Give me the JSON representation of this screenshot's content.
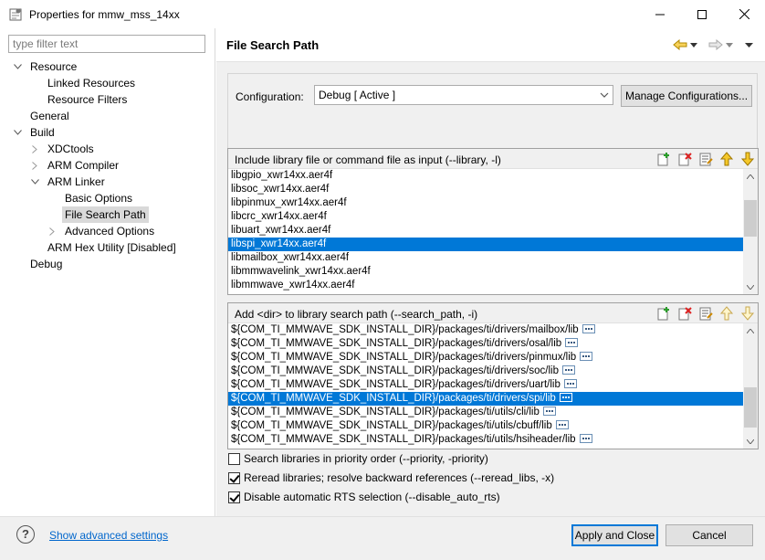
{
  "window": {
    "title": "Properties for mmw_mss_14xx"
  },
  "filter": {
    "placeholder": "type filter text"
  },
  "tree": {
    "resource": "Resource",
    "linked_resources": "Linked Resources",
    "resource_filters": "Resource Filters",
    "general": "General",
    "build": "Build",
    "xdctools": "XDCtools",
    "arm_compiler": "ARM Compiler",
    "arm_linker": "ARM Linker",
    "basic_options": "Basic Options",
    "file_search_path": "File Search Path",
    "advanced_options": "Advanced Options",
    "arm_hex_utility": "ARM Hex Utility  [Disabled]",
    "debug": "Debug"
  },
  "page": {
    "title": "File Search Path"
  },
  "configuration": {
    "label": "Configuration:",
    "value": "Debug  [ Active ]",
    "manage_label": "Manage Configurations..."
  },
  "library_list": {
    "title": "Include library file or command file as input (--library, -l)",
    "items": [
      "libgpio_xwr14xx.aer4f",
      "libsoc_xwr14xx.aer4f",
      "libpinmux_xwr14xx.aer4f",
      "libcrc_xwr14xx.aer4f",
      "libuart_xwr14xx.aer4f",
      "libspi_xwr14xx.aer4f",
      "libmailbox_xwr14xx.aer4f",
      "libmmwavelink_xwr14xx.aer4f",
      "libmmwave_xwr14xx.aer4f"
    ],
    "selected_index": 5
  },
  "search_path_list": {
    "title": "Add <dir> to library search path (--search_path, -i)",
    "items": [
      "${COM_TI_MMWAVE_SDK_INSTALL_DIR}/packages/ti/drivers/mailbox/lib",
      "${COM_TI_MMWAVE_SDK_INSTALL_DIR}/packages/ti/drivers/osal/lib",
      "${COM_TI_MMWAVE_SDK_INSTALL_DIR}/packages/ti/drivers/pinmux/lib",
      "${COM_TI_MMWAVE_SDK_INSTALL_DIR}/packages/ti/drivers/soc/lib",
      "${COM_TI_MMWAVE_SDK_INSTALL_DIR}/packages/ti/drivers/uart/lib",
      "${COM_TI_MMWAVE_SDK_INSTALL_DIR}/packages/ti/drivers/spi/lib",
      "${COM_TI_MMWAVE_SDK_INSTALL_DIR}/packages/ti/utils/cli/lib",
      "${COM_TI_MMWAVE_SDK_INSTALL_DIR}/packages/ti/utils/cbuff/lib",
      "${COM_TI_MMWAVE_SDK_INSTALL_DIR}/packages/ti/utils/hsiheader/lib"
    ],
    "selected_index": 5
  },
  "options": {
    "priority_label": "Search libraries in priority order (--priority, -priority)",
    "priority_checked": false,
    "reread_label": "Reread libraries; resolve backward references (--reread_libs, -x)",
    "reread_checked": true,
    "disable_rts_label": "Disable automatic RTS selection (--disable_auto_rts)",
    "disable_rts_checked": true
  },
  "footer": {
    "help_symbol": "?",
    "advanced_link": "Show advanced settings",
    "apply_label": "Apply and Close",
    "cancel_label": "Cancel"
  },
  "colors": {
    "selection": "#0078d7",
    "link": "#0066cc",
    "tree_selection": "#d9d9d9"
  },
  "icons": {
    "toolbar": [
      "add-icon",
      "delete-icon",
      "edit-icon",
      "move-up-icon",
      "move-down-icon"
    ],
    "nav": [
      "back-arrow-icon",
      "forward-arrow-icon",
      "view-menu-icon"
    ]
  }
}
